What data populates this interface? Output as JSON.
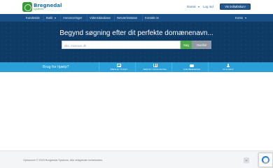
{
  "brand": {
    "name": "Bregnedal",
    "tagline": "systems"
  },
  "topbar": {
    "language": "Dansk",
    "login": "Log ind",
    "cart": "Vis indkøbskurv"
  },
  "nav": {
    "items": [
      {
        "label": "Kundeside",
        "dropdown": false
      },
      {
        "label": "Butik",
        "dropdown": true
      },
      {
        "label": "Annonceringer",
        "dropdown": false
      },
      {
        "label": "Vidensdatabase",
        "dropdown": false
      },
      {
        "label": "Netværksstatus",
        "dropdown": false
      },
      {
        "label": "Kontakt os",
        "dropdown": false
      }
    ],
    "account": "Konto"
  },
  "hero": {
    "title": "Begynd søgning efter dit perfekte domænenavn...",
    "search_placeholder": "eks. minnavn.dk",
    "search_button": "Søg",
    "transfer_button": "Overfør"
  },
  "helpbar": {
    "title": "Brug for hjælp?",
    "items": [
      {
        "label": "ÅBEN ET TICKET",
        "icon": "ticket-icon"
      },
      {
        "label": "BESTILT KATALOG/TEL.",
        "icon": "book-icon"
      },
      {
        "label": "LIVE BESKEDNG",
        "icon": "chat-icon"
      },
      {
        "label": "FÅ HJÆLP",
        "icon": "user-icon"
      }
    ]
  },
  "footer": {
    "copyright": "Ophavsret © 2023 Bregnedal Systems. Alle rettigheder forbeholdes."
  },
  "colors": {
    "navbar": "#1a5088",
    "hero": "#0e3a66",
    "helpbar": "#2a9fd8",
    "search_button": "#4ea84e",
    "transfer_button": "#8f9aa5",
    "cart_button": "#23568a"
  }
}
